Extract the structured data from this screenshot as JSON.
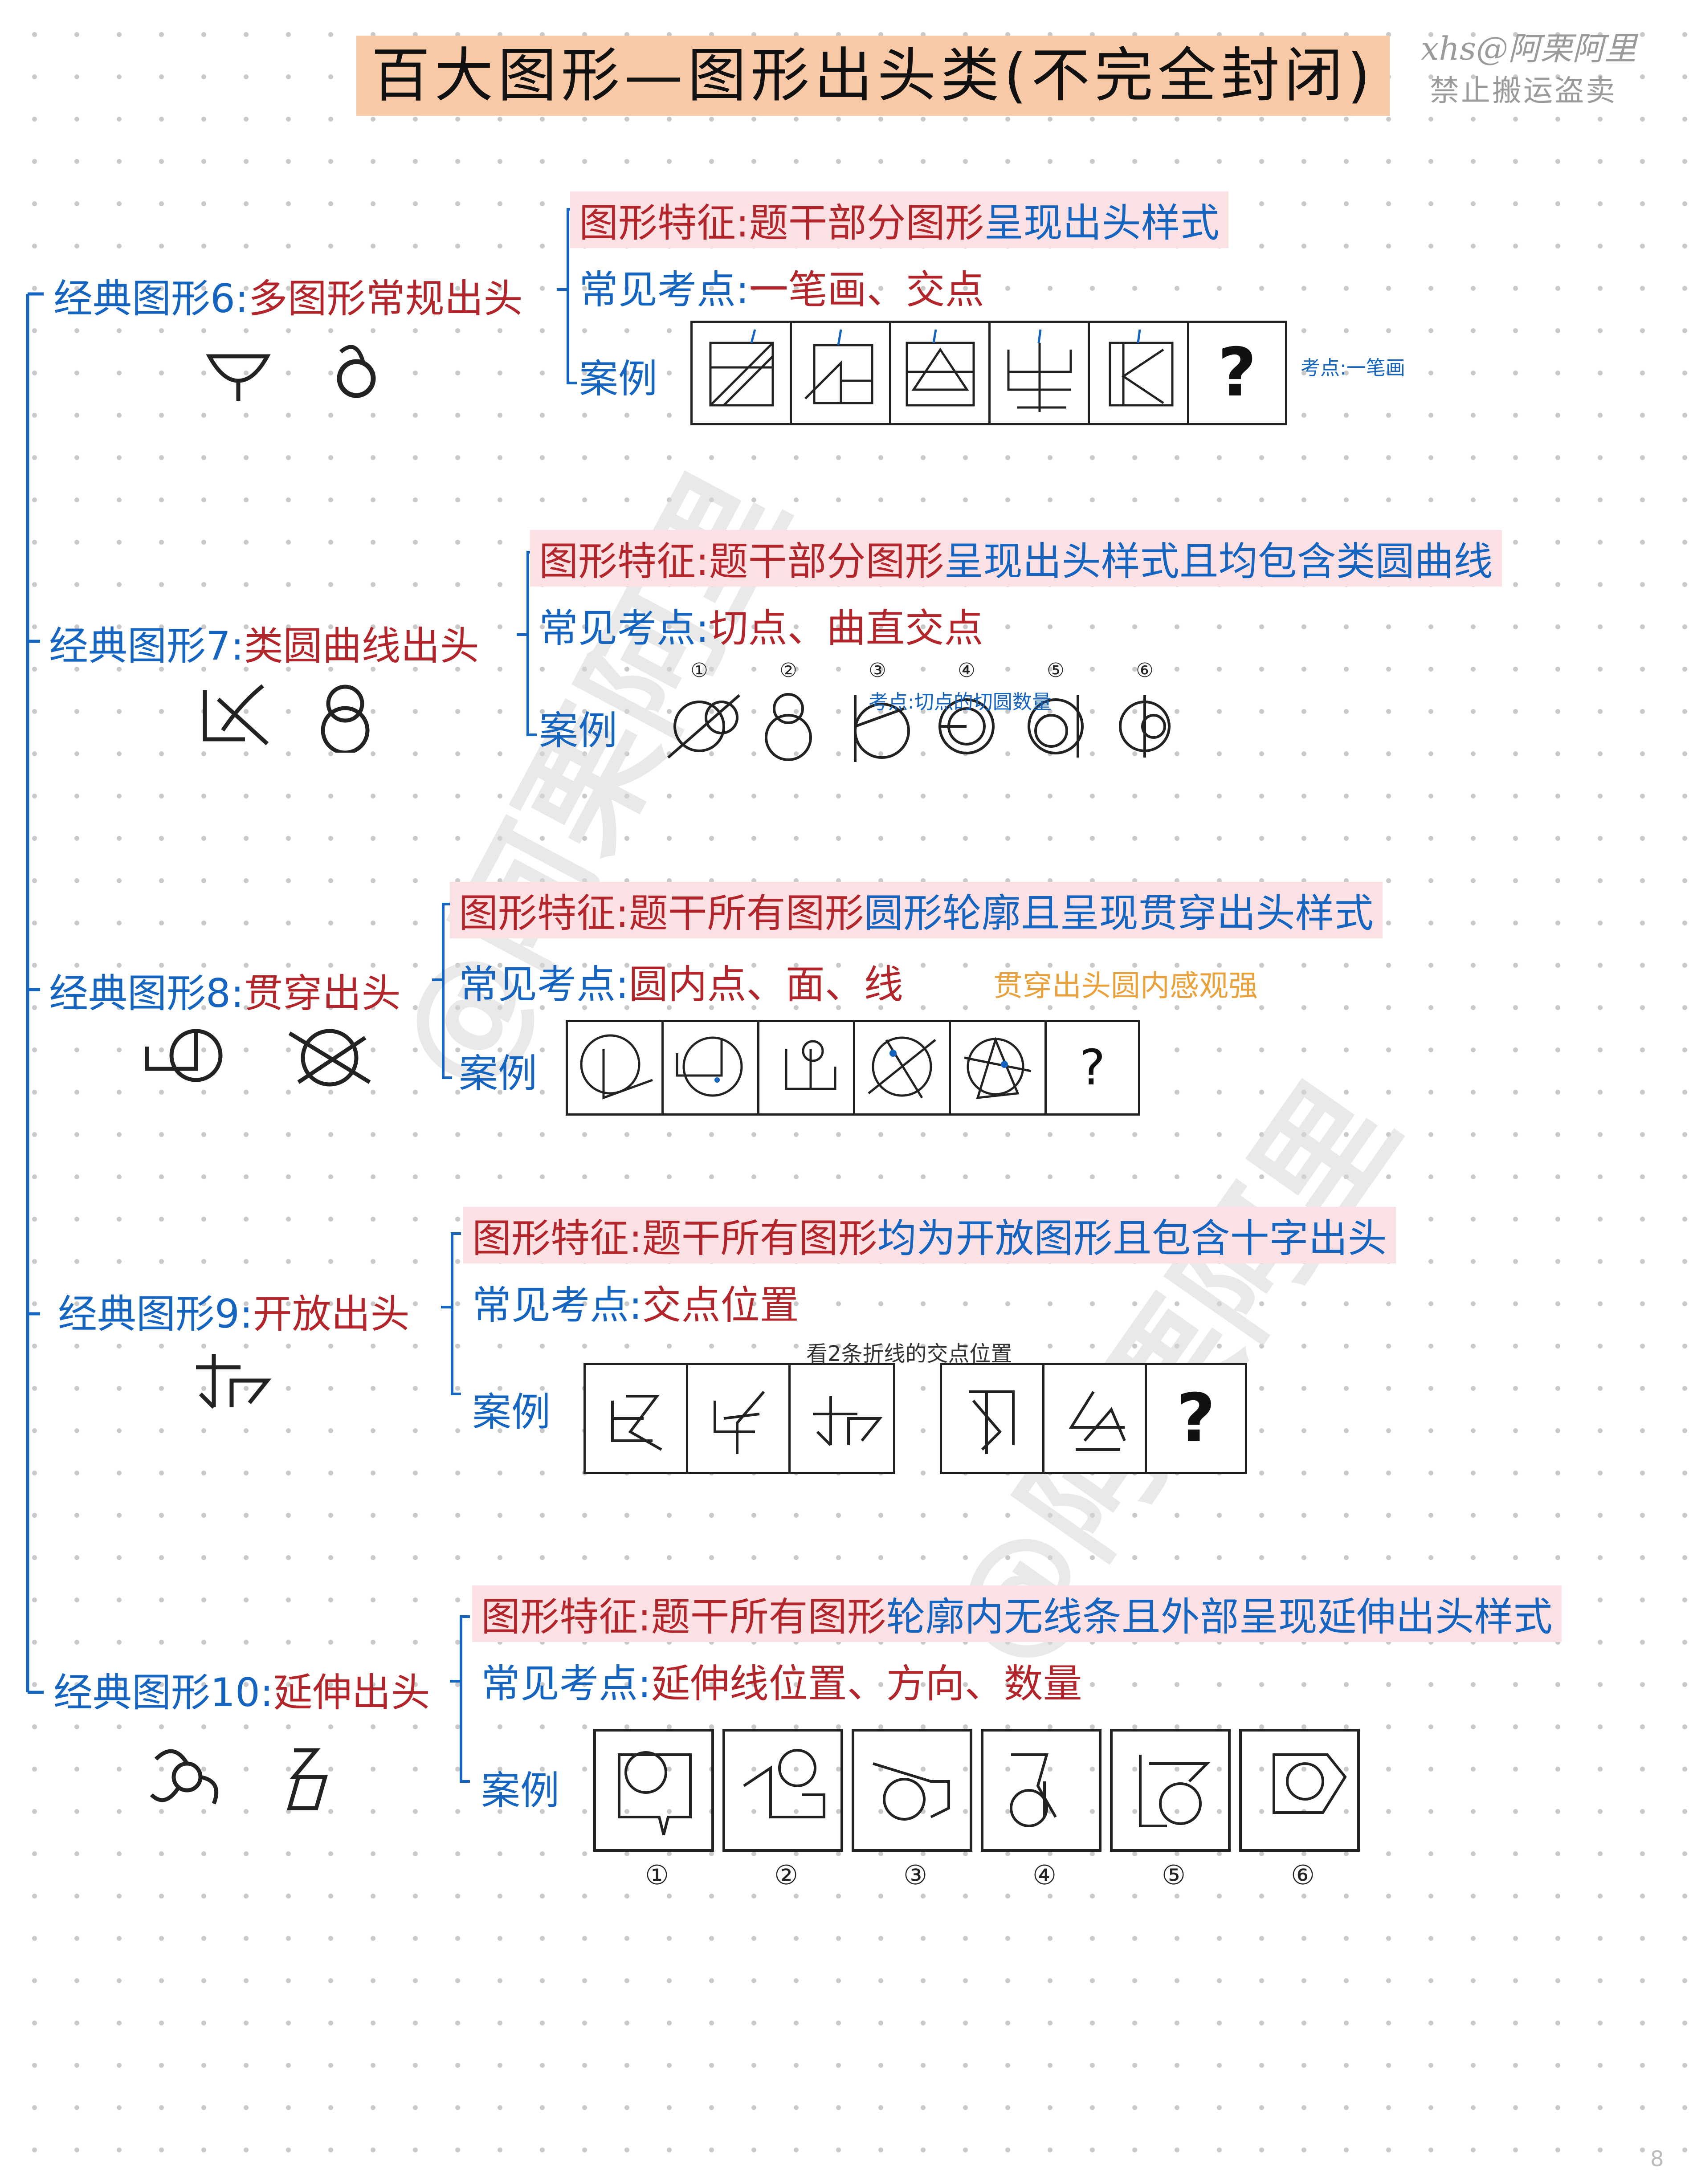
{
  "header": {
    "title": "百大图形—图形出头类(不完全封闭)",
    "watermark_line1": "xhs@阿栗阿里",
    "watermark_line2": "禁止搬运盗卖"
  },
  "big_watermark": "@阿栗阿里",
  "page_number": "8",
  "sections": [
    {
      "title_prefix": "经典图形6:",
      "title_suffix": "多图形常规出头",
      "feature_label": "图形特征:",
      "feature_text_a": "题干部分图形",
      "feature_text_b": "呈现出头样式",
      "points_label": "常见考点:",
      "points_text": "一笔画、交点",
      "case_label": "案例",
      "note": "考点:一笔画",
      "question_mark": "?"
    },
    {
      "title_prefix": "经典图形7:",
      "title_suffix": "类圆曲线出头",
      "feature_label": "图形特征:",
      "feature_text_a": "题干部分图形",
      "feature_text_b": "呈现出头样式且均包含类圆曲线",
      "points_label": "常见考点:",
      "points_text": "切点、曲直交点",
      "case_label": "案例",
      "note": "考点:切点的切圆数量",
      "numbers": [
        "①",
        "②",
        "③",
        "④",
        "⑤",
        "⑥"
      ]
    },
    {
      "title_prefix": "经典图形8:",
      "title_suffix": "贯穿出头",
      "feature_label": "图形特征:",
      "feature_text_a": "题干所有图形",
      "feature_text_b": "圆形轮廓且呈现贯穿出头样式",
      "points_label": "常见考点:",
      "points_text": "圆内点、面、线",
      "extra_note": "贯穿出头圆内感观强",
      "case_label": "案例",
      "question_mark": "?"
    },
    {
      "title_prefix": "经典图形9:",
      "title_suffix": "开放出头",
      "feature_label": "图形特征:",
      "feature_text_a": "题干所有图形",
      "feature_text_b": "均为开放图形且包含十字出头",
      "points_label": "常见考点:",
      "points_text": "交点位置",
      "case_label": "案例",
      "note": "看2条折线的交点位置",
      "question_mark": "?"
    },
    {
      "title_prefix": "经典图形10:",
      "title_suffix": "延伸出头",
      "feature_label": "图形特征:",
      "feature_text_a": "题干所有图形",
      "feature_text_b": "轮廓内无线条且外部呈现延伸出头样式",
      "points_label": "常见考点:",
      "points_text": "延伸线位置、方向、数量",
      "case_label": "案例",
      "numbers": [
        "①",
        "②",
        "③",
        "④",
        "⑤",
        "⑥"
      ]
    }
  ]
}
